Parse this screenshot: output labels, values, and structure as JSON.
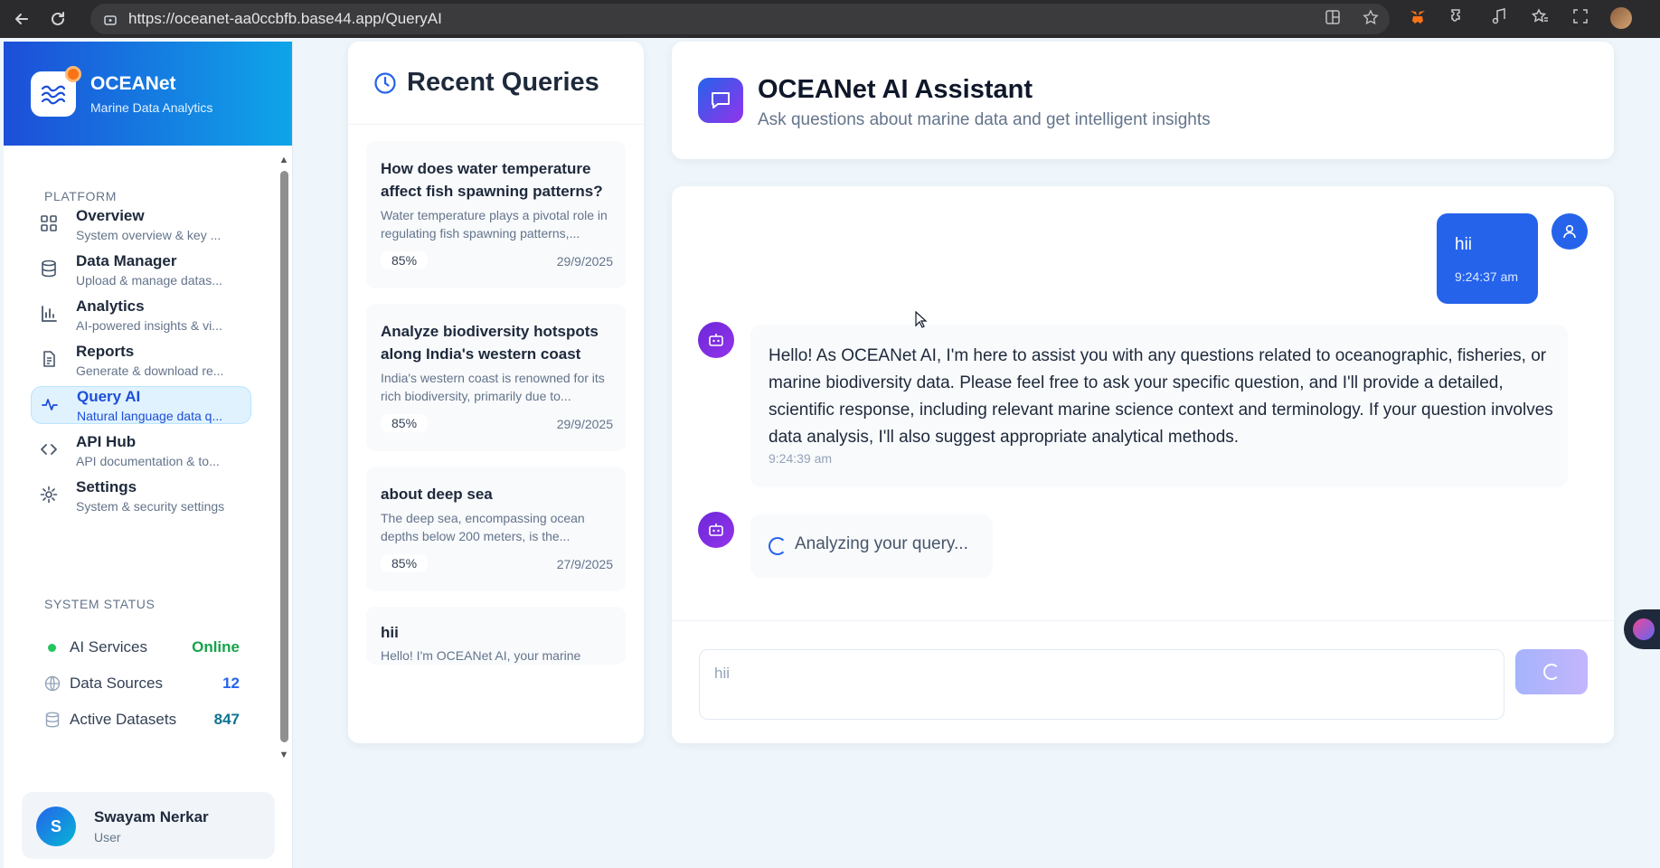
{
  "browser": {
    "url": "https://oceanet-aa0ccbfb.base44.app/QueryAI",
    "back_icon": "back-arrow-icon",
    "reload_icon": "reload-icon"
  },
  "brand": {
    "title": "OCEANet",
    "subtitle": "Marine Data Analytics"
  },
  "sidebar": {
    "platform_label": "PLATFORM",
    "items": [
      {
        "label": "Overview",
        "desc": "System overview & key ...",
        "icon": "grid-icon"
      },
      {
        "label": "Data Manager",
        "desc": "Upload & manage datas...",
        "icon": "database-icon"
      },
      {
        "label": "Analytics",
        "desc": "AI-powered insights & vi...",
        "icon": "bar-chart-icon"
      },
      {
        "label": "Reports",
        "desc": "Generate & download re...",
        "icon": "document-icon"
      },
      {
        "label": "Query AI",
        "desc": "Natural language data q...",
        "icon": "activity-icon"
      },
      {
        "label": "API Hub",
        "desc": "API documentation & to...",
        "icon": "code-icon"
      },
      {
        "label": "Settings",
        "desc": "System & security settings",
        "icon": "gear-icon"
      }
    ],
    "status_label": "SYSTEM STATUS",
    "status": [
      {
        "label": "AI Services",
        "value": "Online"
      },
      {
        "label": "Data Sources",
        "value": "12"
      },
      {
        "label": "Active Datasets",
        "value": "847"
      }
    ]
  },
  "user": {
    "initial": "S",
    "name": "Swayam Nerkar",
    "role": "User"
  },
  "recent": {
    "title": "Recent Queries",
    "queries": [
      {
        "title": "How does water temperature affect fish spawning patterns?",
        "snippet": "Water temperature plays a pivotal role in regulating fish spawning patterns,...",
        "score": "85%",
        "date": "29/9/2025"
      },
      {
        "title": "Analyze biodiversity hotspots along India's western coast",
        "snippet": "India's western coast is renowned for its rich biodiversity, primarily due to...",
        "score": "85%",
        "date": "29/9/2025"
      },
      {
        "title": "about deep sea",
        "snippet": "The deep sea, encompassing ocean depths below 200 meters, is the...",
        "score": "85%",
        "date": "27/9/2025"
      },
      {
        "title": "hii",
        "snippet": "Hello! I'm OCEANet AI, your marine"
      }
    ]
  },
  "assistant": {
    "title": "OCEANet AI Assistant",
    "subtitle": "Ask questions about marine data and get intelligent insights"
  },
  "chat": {
    "user_message": "hii",
    "user_time": "9:24:37 am",
    "bot_message": "Hello! As OCEANet AI, I'm here to assist you with any questions related to oceanographic, fisheries, or marine biodiversity data. Please feel free to ask your specific question, and I'll provide a detailed, scientific response, including relevant marine science context and terminology. If your question involves data analysis, I'll also suggest appropriate analytical methods.",
    "bot_time": "9:24:39 am",
    "thinking": "Analyzing your query...",
    "input_placeholder": "hii"
  },
  "colors": {
    "brand_gradient_start": "#1d4ed8",
    "brand_gradient_end": "#0ea5e9",
    "accent": "#2563eb",
    "online": "#22c55e",
    "count": "#0e7490"
  }
}
